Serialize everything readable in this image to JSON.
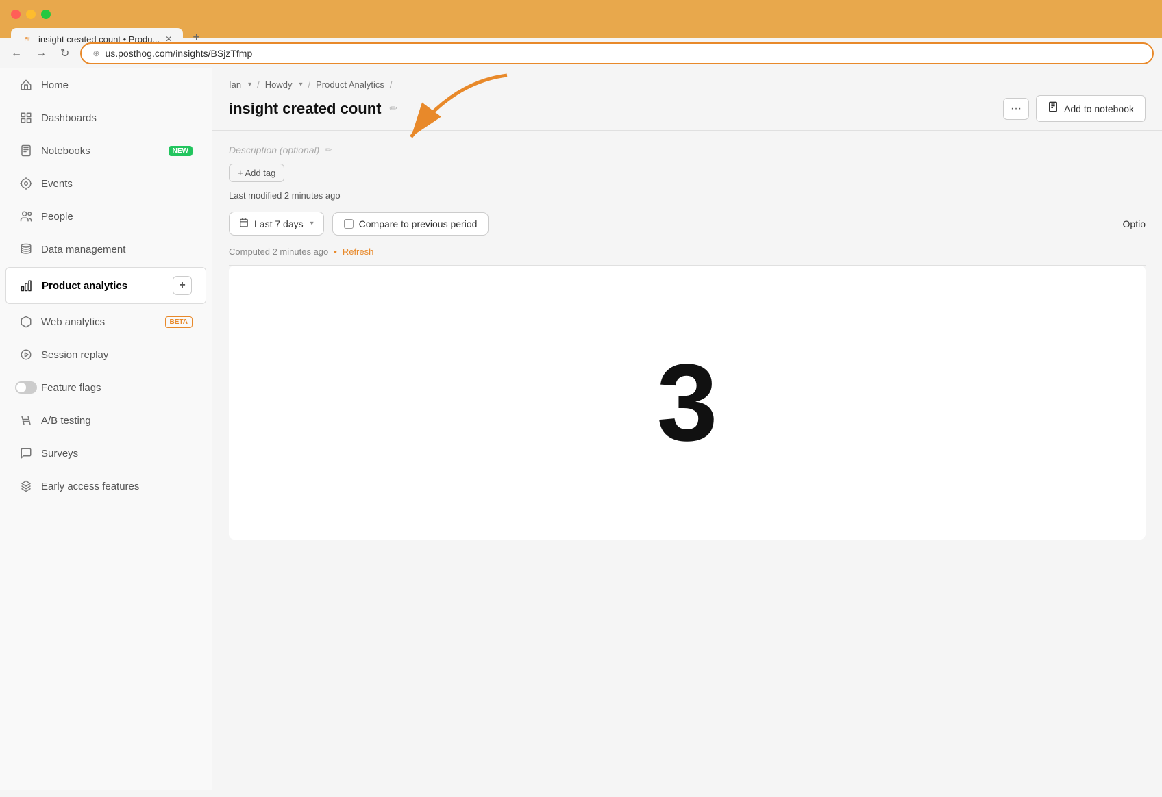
{
  "browser": {
    "tab_title": "insight created count • Produ...",
    "tab_favicon": "≋",
    "url": "us.posthog.com/insights/BSjzTfmp",
    "new_tab_icon": "+"
  },
  "nav_buttons": {
    "back": "←",
    "forward": "→",
    "refresh": "↻"
  },
  "breadcrumb": {
    "items": [
      "Ian",
      "Howdy",
      "Product Analytics"
    ],
    "separator": "/"
  },
  "header": {
    "title": "insight created count",
    "edit_icon": "✏",
    "more_icon": "···",
    "add_notebook_label": "Add to notebook",
    "description_placeholder": "Description (optional)",
    "add_tag_label": "+ Add tag",
    "last_modified": "Last modified 2 minutes ago"
  },
  "filters": {
    "date_range": "Last 7 days",
    "compare_label": "Compare to previous period",
    "options_label": "Optio"
  },
  "computed": {
    "text": "Computed 2 minutes ago",
    "dot": "•",
    "refresh_label": "Refresh"
  },
  "chart": {
    "big_number": "3"
  },
  "sidebar": {
    "items": [
      {
        "id": "home",
        "label": "Home",
        "icon": "home"
      },
      {
        "id": "dashboards",
        "label": "Dashboards",
        "icon": "dashboards"
      },
      {
        "id": "notebooks",
        "label": "Notebooks",
        "icon": "notebooks",
        "badge": "NEW"
      },
      {
        "id": "events",
        "label": "Events",
        "icon": "events"
      },
      {
        "id": "people",
        "label": "People",
        "icon": "people"
      },
      {
        "id": "data-management",
        "label": "Data management",
        "icon": "data-management"
      },
      {
        "id": "product-analytics",
        "label": "Product analytics",
        "icon": "product-analytics",
        "active": true
      },
      {
        "id": "web-analytics",
        "label": "Web analytics",
        "icon": "web-analytics",
        "badge": "BETA"
      },
      {
        "id": "session-replay",
        "label": "Session replay",
        "icon": "session-replay"
      },
      {
        "id": "feature-flags",
        "label": "Feature flags",
        "icon": "feature-flags"
      },
      {
        "id": "ab-testing",
        "label": "A/B testing",
        "icon": "ab-testing"
      },
      {
        "id": "surveys",
        "label": "Surveys",
        "icon": "surveys"
      },
      {
        "id": "early-access",
        "label": "Early access features",
        "icon": "early-access"
      }
    ]
  }
}
